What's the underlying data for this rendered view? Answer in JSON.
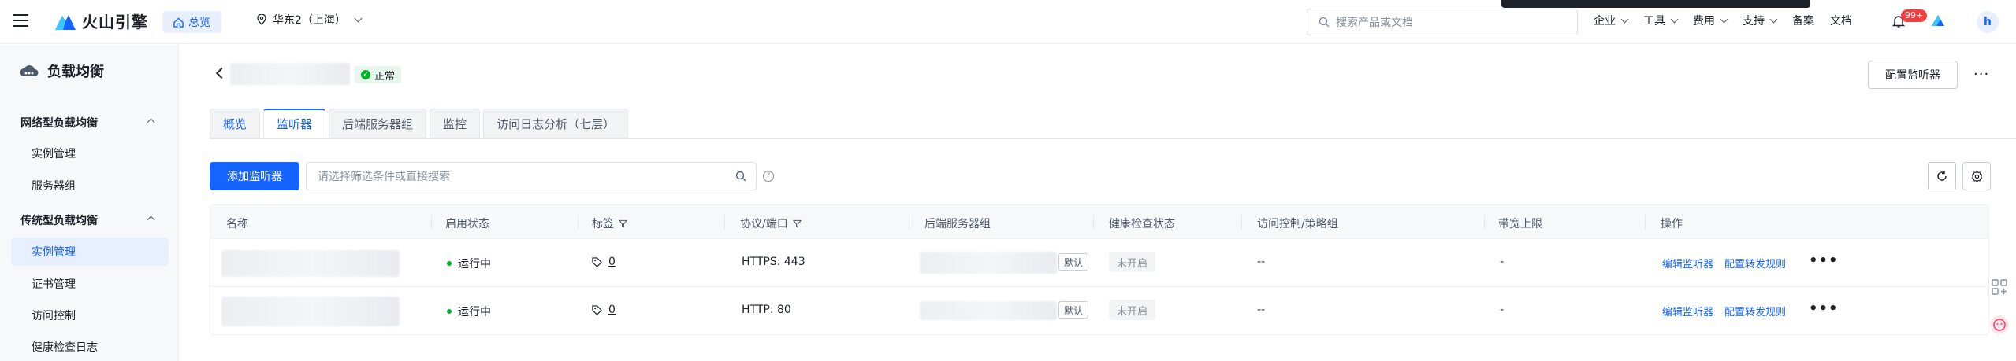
{
  "topbar": {
    "brand": "火山引擎",
    "home_label": "总览",
    "region_label": "华东2（上海）",
    "search_placeholder": "搜索产品或文档",
    "nav": [
      "企业",
      "工具",
      "费用",
      "支持",
      "备案",
      "文档"
    ],
    "badge": "99+",
    "avatar_letter": "h"
  },
  "sidebar": {
    "title": "负载均衡",
    "groups": [
      {
        "label": "网络型负载均衡",
        "items": [
          "实例管理",
          "服务器组"
        ]
      },
      {
        "label": "传统型负载均衡",
        "items": [
          "实例管理",
          "证书管理",
          "访问控制",
          "健康检查日志"
        ]
      }
    ],
    "active_item": "实例管理"
  },
  "header": {
    "status": "正常",
    "config_button": "配置监听器",
    "more": "···"
  },
  "tabs": [
    "概览",
    "监听器",
    "后端服务器组",
    "监控",
    "访问日志分析（七层）"
  ],
  "active_tab": "监听器",
  "toolbar": {
    "add_button": "添加监听器",
    "filter_placeholder": "请选择筛选条件或直接搜索"
  },
  "table": {
    "columns": [
      "名称",
      "启用状态",
      "标签",
      "协议/端口",
      "后端服务器组",
      "健康检查状态",
      "访问控制/策略组",
      "带宽上限",
      "操作"
    ],
    "rows": [
      {
        "status": "运行中",
        "tag_count": "0",
        "protocol": "HTTPS: 443",
        "default": "默认",
        "health": "未开启",
        "acl": "--",
        "bandwidth": "-",
        "action1": "编辑监听器",
        "action2": "配置转发规则",
        "more": "•••"
      },
      {
        "status": "运行中",
        "tag_count": "0",
        "protocol": "HTTP: 80",
        "default": "默认",
        "health": "未开启",
        "acl": "--",
        "bandwidth": "-",
        "action1": "编辑监听器",
        "action2": "配置转发规则",
        "more": "•••"
      }
    ]
  },
  "colors": {
    "primary": "#1664ff",
    "success": "#00b42a",
    "danger": "#f53f3f"
  }
}
